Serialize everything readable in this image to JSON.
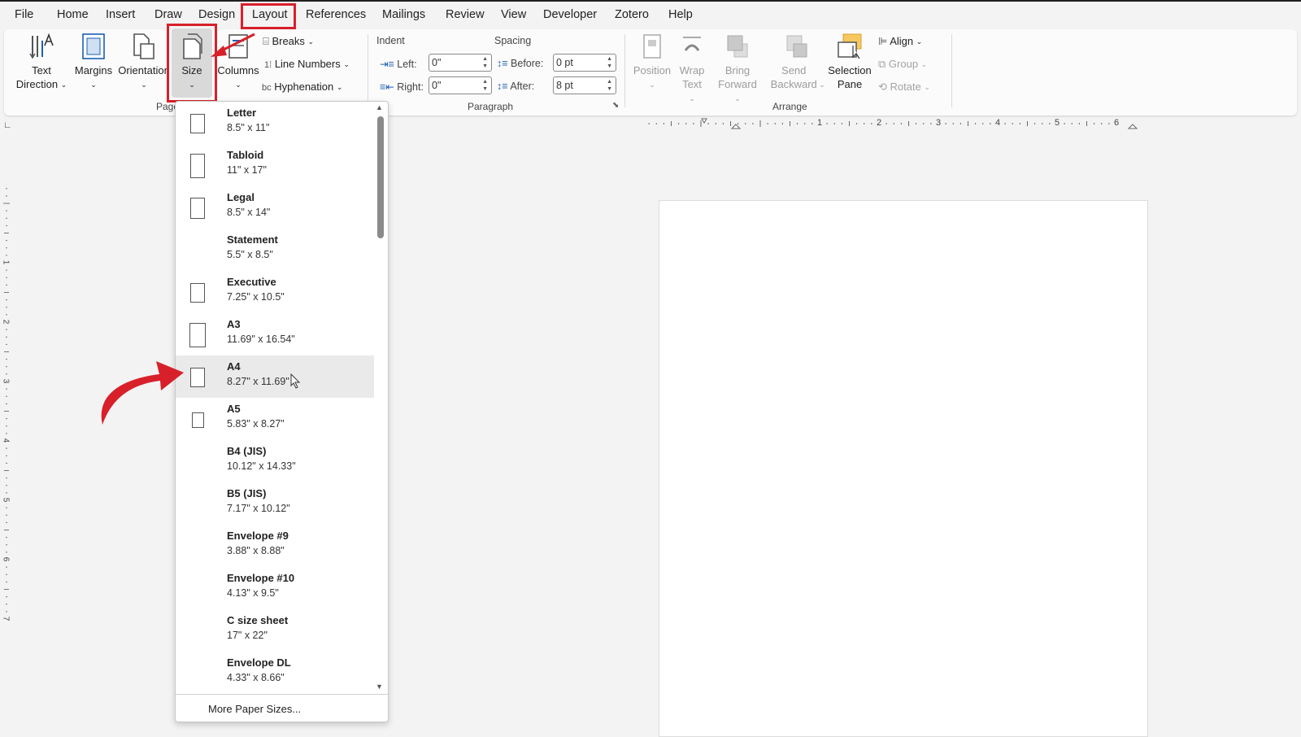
{
  "menu": {
    "tabs": [
      "File",
      "Home",
      "Insert",
      "Draw",
      "Design",
      "Layout",
      "References",
      "Mailings",
      "Review",
      "View",
      "Developer",
      "Zotero",
      "Help"
    ],
    "active": "Layout"
  },
  "ribbon": {
    "page_setup": {
      "text_direction": "Text Direction",
      "margins": "Margins",
      "orientation": "Orientation",
      "size": "Size",
      "columns": "Columns",
      "breaks": "Breaks",
      "line_numbers": "Line Numbers",
      "hyphenation": "Hyphenation",
      "group_label": "Page"
    },
    "paragraph": {
      "indent_label": "Indent",
      "spacing_label": "Spacing",
      "left_label": "Left:",
      "left_value": "0\"",
      "right_label": "Right:",
      "right_value": "0\"",
      "before_label": "Before:",
      "before_value": "0 pt",
      "after_label": "After:",
      "after_value": "8 pt",
      "group_label": "Paragraph"
    },
    "arrange": {
      "position": "Position",
      "wrap_text": "Wrap Text",
      "bring_forward": "Bring Forward",
      "send_backward": "Send Backward",
      "selection_pane": "Selection Pane",
      "align": "Align",
      "group": "Group",
      "rotate": "Rotate",
      "group_label": "Arrange"
    }
  },
  "ruler": {
    "labels": [
      "1",
      "2",
      "3",
      "4",
      "5",
      "6"
    ],
    "vertical_labels": [
      "1",
      "2",
      "3",
      "4",
      "5",
      "6",
      "7"
    ]
  },
  "size_menu": {
    "items": [
      {
        "name": "Letter",
        "dims": "8.5\" x 11\"",
        "icon": true
      },
      {
        "name": "Tabloid",
        "dims": "11\" x 17\"",
        "icon": true
      },
      {
        "name": "Legal",
        "dims": "8.5\" x 14\"",
        "icon": true
      },
      {
        "name": "Statement",
        "dims": "5.5\" x 8.5\"",
        "icon": false
      },
      {
        "name": "Executive",
        "dims": "7.25\" x 10.5\"",
        "icon": true
      },
      {
        "name": "A3",
        "dims": "11.69\" x 16.54\"",
        "icon": true
      },
      {
        "name": "A4",
        "dims": "8.27\" x 11.69\"",
        "icon": true
      },
      {
        "name": "A5",
        "dims": "5.83\" x 8.27\"",
        "icon": true
      },
      {
        "name": "B4 (JIS)",
        "dims": "10.12\" x 14.33\"",
        "icon": false
      },
      {
        "name": "B5 (JIS)",
        "dims": "7.17\" x 10.12\"",
        "icon": false
      },
      {
        "name": "Envelope #9",
        "dims": "3.88\" x 8.88\"",
        "icon": false
      },
      {
        "name": "Envelope #10",
        "dims": "4.13\" x 9.5\"",
        "icon": false
      },
      {
        "name": "C size sheet",
        "dims": "17\" x 22\"",
        "icon": false
      },
      {
        "name": "Envelope DL",
        "dims": "4.33\" x 8.66\"",
        "icon": false
      }
    ],
    "hovered": "A4",
    "more": "More Paper Sizes..."
  },
  "colors": {
    "highlight_red": "#d8202a",
    "accent_blue": "#1b5fb4"
  }
}
